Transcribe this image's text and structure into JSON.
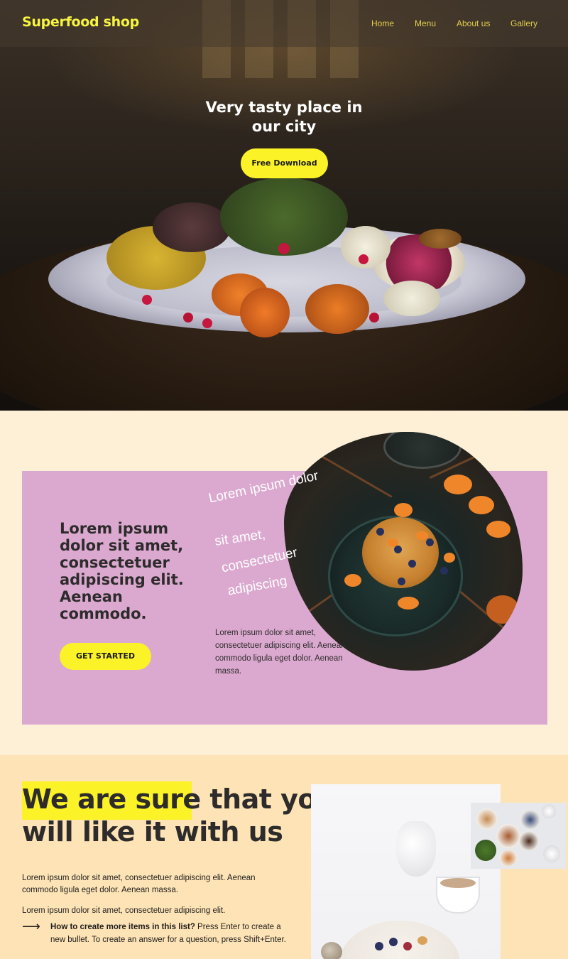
{
  "header": {
    "brand": "Superfood shop",
    "nav": [
      "Home",
      "Menu",
      "About us",
      "Gallery"
    ]
  },
  "hero": {
    "title_line1": "Very tasty place in",
    "title_line2": "our city",
    "cta": "Free Download"
  },
  "feature": {
    "heading": "Lorem ipsum dolor sit amet, consectetuer adipiscing elit. Aenean commodo.",
    "cta": "GET STARTED",
    "wavy_lines": [
      "Lorem ipsum dolor",
      "sit amet,",
      "consectetuer",
      "adipiscing"
    ],
    "paragraph": "Lorem ipsum dolor sit amet, consectetuer adipiscing elit. Aenean commodo ligula eget dolor. Aenean massa."
  },
  "about": {
    "heading_highlight": "We are sure",
    "heading_rest1": " that you",
    "heading_line2": "will like it with us",
    "paragraph1": "Lorem ipsum dolor sit amet, consectetuer adipiscing elit. Aenean commodo ligula eget dolor. Aenean massa.",
    "paragraph2": "Lorem ipsum dolor sit amet, consectetuer adipiscing elit.",
    "list_item_bold": "How to create more items in this list?",
    "list_item_text": " Press Enter to create a new bullet. To create an answer for a question, press Shift+Enter.",
    "arrow": "⟶"
  },
  "colors": {
    "accent_yellow": "#fbf227",
    "lilac": "#dba9cf",
    "cream": "#fef0d7",
    "peach": "#fde3b5"
  }
}
